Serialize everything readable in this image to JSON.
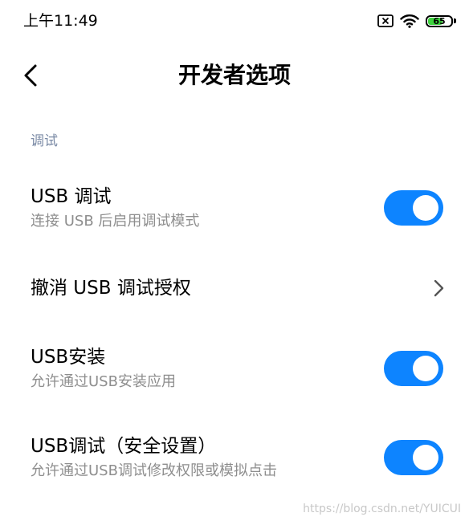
{
  "status_bar": {
    "time": "上午11:49",
    "battery_level": "65",
    "battery_fraction": 0.65,
    "battery_color": "#3ed33e",
    "icons": [
      "no-sim-icon",
      "wifi-icon",
      "battery-icon"
    ]
  },
  "header": {
    "back_icon": "chevron-left-icon",
    "title": "开发者选项"
  },
  "section": {
    "label": "调试"
  },
  "rows": [
    {
      "title": "USB 调试",
      "subtitle": "连接 USB 后启用调试模式",
      "control": "toggle",
      "enabled": true
    },
    {
      "title": "撤消 USB 调试授权",
      "control": "chevron-right-icon"
    },
    {
      "title": "USB安装",
      "subtitle": "允许通过USB安装应用",
      "control": "toggle",
      "enabled": true
    },
    {
      "title": "USB调试（安全设置）",
      "subtitle": "允许通过USB调试修改权限或模拟点击",
      "control": "toggle",
      "enabled": true
    }
  ],
  "colors": {
    "toggle_on": "#0d84ff",
    "section_label": "#7a8aa5",
    "subtitle": "#8e8e8e"
  },
  "watermark": "https://blog.csdn.net/YUICUI"
}
